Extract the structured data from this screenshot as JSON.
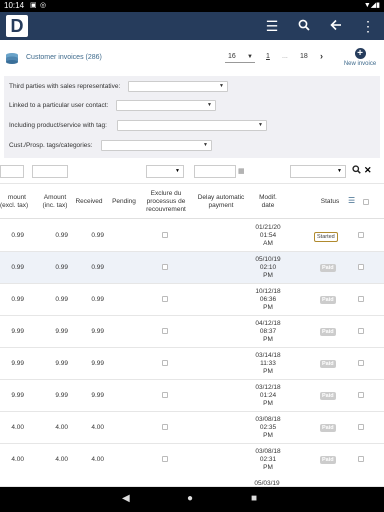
{
  "status_bar": {
    "time": "10:14",
    "icons": [
      "storage-icon",
      "alert-icon"
    ]
  },
  "app_bar": {
    "logo_letter": "D"
  },
  "header": {
    "title": "Customer invoices (286)",
    "page_size": "16",
    "page_current": "1",
    "page_ellipsis": "...",
    "page_last": "18",
    "new_invoice": "New invoice"
  },
  "filters": {
    "sales_rep_label": "Third parties with sales representative:",
    "user_contact_label": "Linked to a particular user contact:",
    "product_tag_label": "Including product/service with tag:",
    "prosp_tag_label": "Cust./Prosp. tags/categories:"
  },
  "columns": {
    "amount_excl": "mount\n(excl. tax)",
    "amount_incl": "Amount\n(inc. tax)",
    "received": "Received",
    "pending": "Pending",
    "exclude_recovery": "Exclure du\nprocessus de\nrecouvrement",
    "delay_payment": "Delay automatic\npayment",
    "modif_date": "Modif.\ndate",
    "status": "Status"
  },
  "rows": [
    {
      "amount_excl": "0.99",
      "amount_incl": "0.99",
      "received": "0.99",
      "date": "01/21/20\n01:54\nAM",
      "status": "Started"
    },
    {
      "amount_excl": "0.99",
      "amount_incl": "0.99",
      "received": "0.99",
      "date": "05/10/19\n02:10\nPM",
      "status": "Paid"
    },
    {
      "amount_excl": "0.99",
      "amount_incl": "0.99",
      "received": "0.99",
      "date": "10/12/18\n06:36\nPM",
      "status": "Paid"
    },
    {
      "amount_excl": "9.99",
      "amount_incl": "9.99",
      "received": "9.99",
      "date": "04/12/18\n08:37\nPM",
      "status": "Paid"
    },
    {
      "amount_excl": "9.99",
      "amount_incl": "9.99",
      "received": "9.99",
      "date": "03/14/18\n11:33\nPM",
      "status": "Paid"
    },
    {
      "amount_excl": "9.99",
      "amount_incl": "9.99",
      "received": "9.99",
      "date": "03/12/18\n01:24\nPM",
      "status": "Paid"
    },
    {
      "amount_excl": "4.00",
      "amount_incl": "4.00",
      "received": "4.00",
      "date": "03/08/18\n02:35\nPM",
      "status": "Paid"
    },
    {
      "amount_excl": "4.00",
      "amount_incl": "4.00",
      "received": "4.00",
      "date": "03/08/18\n02:31\nPM",
      "status": "Paid"
    }
  ],
  "partial_row": {
    "date": "05/03/19"
  }
}
